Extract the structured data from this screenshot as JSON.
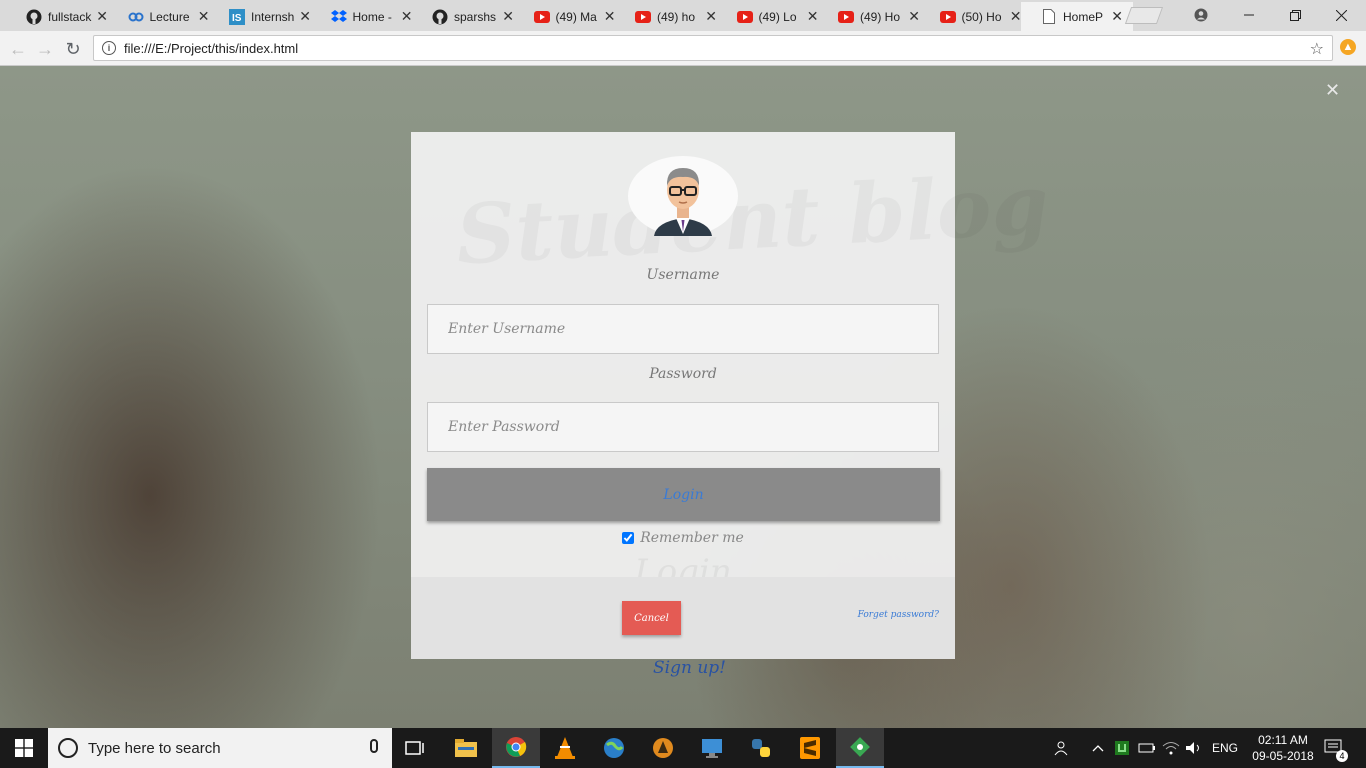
{
  "browser": {
    "tabs": [
      {
        "label": "fullstack",
        "icon": "github-icon"
      },
      {
        "label": "Lecture",
        "icon": "coursera-icon"
      },
      {
        "label": "Internsh",
        "icon": "internshala-icon"
      },
      {
        "label": "Home -",
        "icon": "dropbox-icon"
      },
      {
        "label": "sparshs",
        "icon": "github-icon"
      },
      {
        "label": "(49) Ma",
        "icon": "youtube-icon"
      },
      {
        "label": "(49) ho",
        "icon": "youtube-icon"
      },
      {
        "label": "(49) Lo",
        "icon": "youtube-icon"
      },
      {
        "label": "(49) Ho",
        "icon": "youtube-icon"
      },
      {
        "label": "(50) Ho",
        "icon": "youtube-icon"
      },
      {
        "label": "HomeP",
        "icon": "page-icon"
      }
    ],
    "url": "file:///E:/Project/this/index.html"
  },
  "page": {
    "close_symbol": "✕",
    "watermark": "Student blog",
    "username_label": "Username",
    "username_placeholder": "Enter Username",
    "password_label": "Password",
    "password_placeholder": "Enter Password",
    "login_button": "Login",
    "remember_label": "Remember me",
    "remember_checked": true,
    "ghost_title": "Login",
    "cancel_button": "Cancel",
    "forgot_link": "Forget password?",
    "signup_link": "Sign up!",
    "colors": {
      "link": "#3a7bd5",
      "cancel": "#e45b54",
      "login_bg": "#8a8a8a"
    }
  },
  "taskbar": {
    "search_placeholder": "Type here to search",
    "language": "ENG",
    "time": "02:11 AM",
    "date": "09-05-2018",
    "notification_count": "4"
  }
}
